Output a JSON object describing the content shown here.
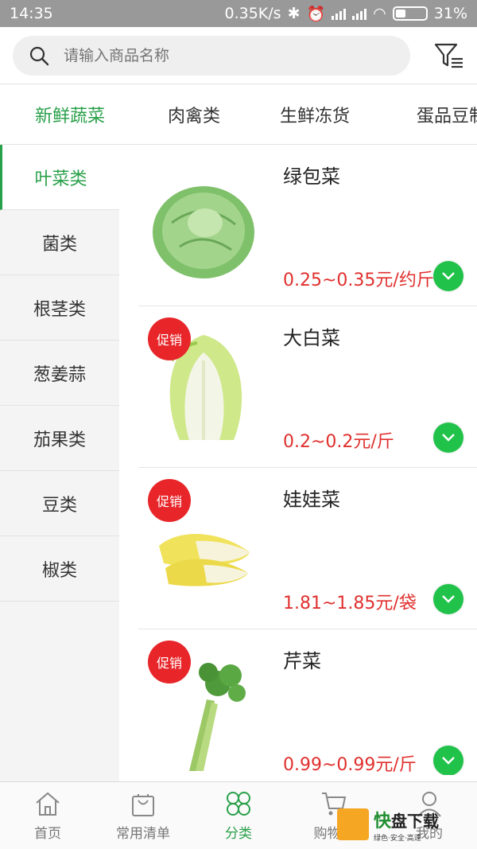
{
  "status_bar": {
    "time": "14:35",
    "speed": "0.35K/s",
    "battery": "31%"
  },
  "search": {
    "placeholder": "请输入商品名称"
  },
  "tabs": [
    {
      "label": "新鲜蔬菜",
      "active": true
    },
    {
      "label": "肉禽类"
    },
    {
      "label": "生鲜冻货"
    },
    {
      "label": "蛋品豆制品"
    }
  ],
  "sidebar": {
    "items": [
      {
        "label": "叶菜类",
        "active": true
      },
      {
        "label": "菌类"
      },
      {
        "label": "根茎类"
      },
      {
        "label": "葱姜蒜"
      },
      {
        "label": "茄果类"
      },
      {
        "label": "豆类"
      },
      {
        "label": "椒类"
      }
    ]
  },
  "products": [
    {
      "name": "绿包菜",
      "price": "0.25~0.35元/约斤",
      "promo": false,
      "image": "cabbage"
    },
    {
      "name": "大白菜",
      "price": "0.2~0.2元/斤",
      "promo": true,
      "image": "napa-cabbage"
    },
    {
      "name": "娃娃菜",
      "price": "1.81~1.85元/袋",
      "promo": true,
      "image": "baby-cabbage"
    },
    {
      "name": "芹菜",
      "price": "0.99~0.99元/斤",
      "promo": true,
      "image": "celery"
    }
  ],
  "promo_label": "促销",
  "bottom_nav": [
    {
      "label": "首页",
      "icon": "home-icon"
    },
    {
      "label": "常用清单",
      "icon": "bag-icon"
    },
    {
      "label": "分类",
      "icon": "clover-icon",
      "active": true
    },
    {
      "label": "购物车",
      "icon": "cart-icon"
    },
    {
      "label": "我的",
      "icon": "user-icon"
    }
  ],
  "watermark": {
    "brand1": "快",
    "brand2": "盘下载",
    "slogan": "绿色·安全·高速"
  },
  "colors": {
    "accent": "#29a04a",
    "price": "#e0302e",
    "promo": "#e8262a",
    "add_button": "#21c24a"
  }
}
